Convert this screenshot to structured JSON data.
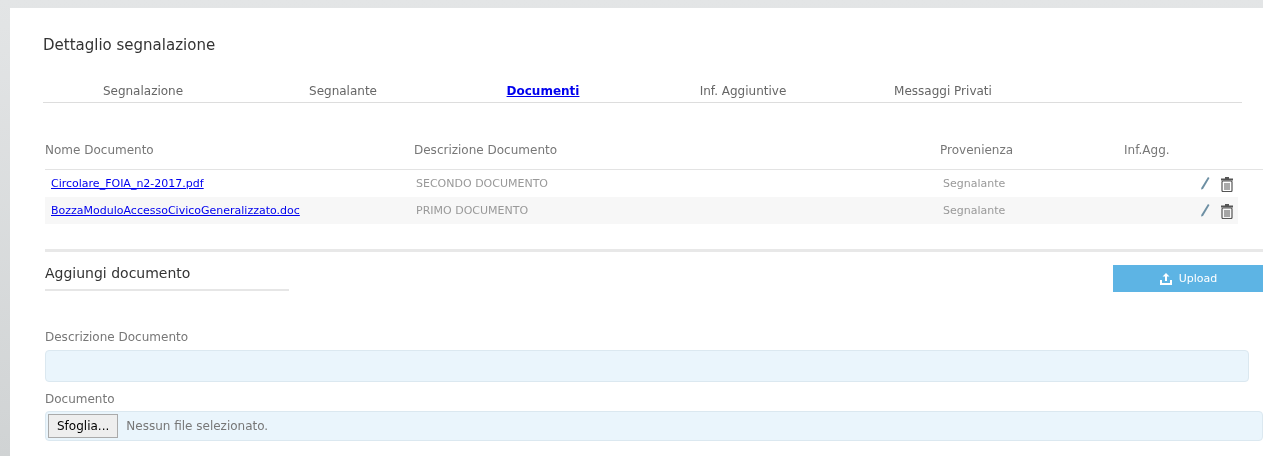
{
  "title": "Dettaglio segnalazione",
  "tabs": [
    {
      "label": "Segnalazione",
      "selected": false
    },
    {
      "label": "Segnalante",
      "selected": false
    },
    {
      "label": "Documenti",
      "selected": true
    },
    {
      "label": "Inf. Aggiuntive",
      "selected": false
    },
    {
      "label": "Messaggi Privati",
      "selected": false
    }
  ],
  "table": {
    "columns": [
      "Nome Documento",
      "Descrizione Documento",
      "Provenienza",
      "Inf.Agg."
    ],
    "rows": [
      {
        "name": "Circolare_FOIA_n2-2017.pdf",
        "description": "SECONDO DOCUMENTO",
        "origin": "Segnalante"
      },
      {
        "name": "BozzaModuloAccessoCivicoGeneralizzato.doc",
        "description": "PRIMO DOCUMENTO",
        "origin": "Segnalante"
      }
    ]
  },
  "add_section": {
    "title": "Aggiungi documento",
    "upload_button": "Upload",
    "description_label": "Descrizione Documento",
    "file_label": "Documento",
    "browse_button": "Sfoglia...",
    "file_status": "Nessun file selezionato."
  }
}
